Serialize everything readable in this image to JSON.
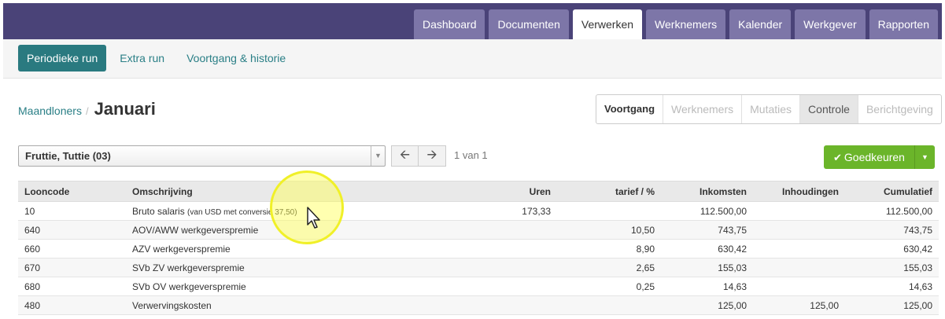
{
  "topnav": {
    "tabs": [
      {
        "label": "Dashboard",
        "active": false
      },
      {
        "label": "Documenten",
        "active": false
      },
      {
        "label": "Verwerken",
        "active": true
      },
      {
        "label": "Werknemers",
        "active": false
      },
      {
        "label": "Kalender",
        "active": false
      },
      {
        "label": "Werkgever",
        "active": false
      },
      {
        "label": "Rapporten",
        "active": false
      }
    ]
  },
  "subnav": {
    "items": [
      {
        "label": "Periodieke run",
        "active": true
      },
      {
        "label": "Extra run",
        "active": false
      },
      {
        "label": "Voortgang & historie",
        "active": false
      }
    ]
  },
  "breadcrumb": {
    "parent": "Maandloners",
    "separator": "/",
    "current": "Januari"
  },
  "steps": [
    {
      "label": "Voortgang",
      "state": "done"
    },
    {
      "label": "Werknemers",
      "state": "disabled"
    },
    {
      "label": "Mutaties",
      "state": "disabled"
    },
    {
      "label": "Controle",
      "state": "current"
    },
    {
      "label": "Berichtgeving",
      "state": "disabled"
    }
  ],
  "employee_select": {
    "value": "Fruttie, Tuttie (03)"
  },
  "pager": {
    "text": "1 van 1"
  },
  "approve_button": {
    "label": "Goedkeuren"
  },
  "colors": {
    "topbar": "#4a4378",
    "tab": "#7d76a8",
    "subnav_active": "#2a7a80",
    "approve": "#6bb52a",
    "link": "#2a7f86"
  },
  "table": {
    "headers": [
      "Looncode",
      "Omschrijving",
      "Uren",
      "tarief / %",
      "Inkomsten",
      "Inhoudingen",
      "Cumulatief"
    ],
    "rows": [
      {
        "looncode": "10",
        "omschrijving": "Bruto salaris",
        "note": "(van USD met conversie 37,50)",
        "uren": "173,33",
        "tarief": "",
        "inkomsten": "112.500,00",
        "inhoudingen": "",
        "cumulatief": "112.500,00"
      },
      {
        "looncode": "640",
        "omschrijving": "AOV/AWW werkgeverspremie",
        "note": "",
        "uren": "",
        "tarief": "10,50",
        "inkomsten": "743,75",
        "inhoudingen": "",
        "cumulatief": "743,75"
      },
      {
        "looncode": "660",
        "omschrijving": "AZV werkgeverspremie",
        "note": "",
        "uren": "",
        "tarief": "8,90",
        "inkomsten": "630,42",
        "inhoudingen": "",
        "cumulatief": "630,42"
      },
      {
        "looncode": "670",
        "omschrijving": "SVb ZV werkgeverspremie",
        "note": "",
        "uren": "",
        "tarief": "2,65",
        "inkomsten": "155,03",
        "inhoudingen": "",
        "cumulatief": "155,03"
      },
      {
        "looncode": "680",
        "omschrijving": "SVb OV werkgeverspremie",
        "note": "",
        "uren": "",
        "tarief": "0,25",
        "inkomsten": "14,63",
        "inhoudingen": "",
        "cumulatief": "14,63"
      },
      {
        "looncode": "480",
        "omschrijving": "Verwervingskosten",
        "note": "",
        "uren": "",
        "tarief": "",
        "inkomsten": "125,00",
        "inhoudingen": "125,00",
        "cumulatief": "125,00"
      }
    ]
  }
}
